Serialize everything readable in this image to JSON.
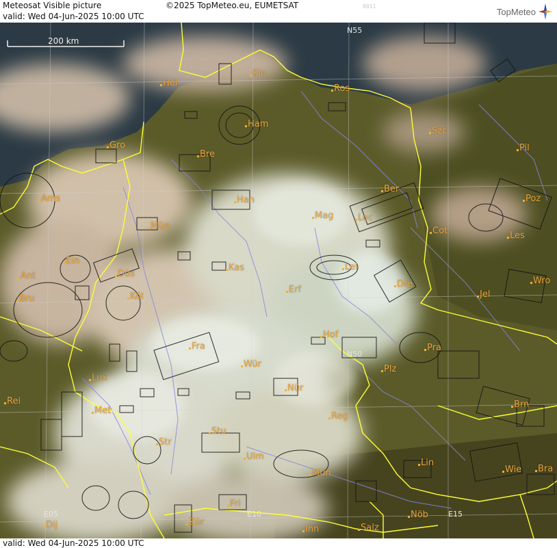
{
  "header": {
    "product_title": "Meteosat Visible picture",
    "copyright": "©2025 TopMeteo.eu, EUMETSAT",
    "image_code": "8011",
    "valid_line": "valid:  Wed  04-Jun-2025  10:00 UTC",
    "logo_text": "TopMeteo"
  },
  "footer": {
    "valid_line": "valid:  Wed  04-Jun-2025  10:00 UTC"
  },
  "map": {
    "scale_label": "200 km",
    "grid_labels": {
      "n55": "N55",
      "n50": "N50",
      "e05": "E05",
      "e10": "E10",
      "e15": "E15"
    },
    "cities": [
      "Kie",
      "Hel",
      "Ros",
      "Ham",
      "Szc",
      "Gro",
      "Bre",
      "Pil",
      "Ams",
      "Han",
      "Ber",
      "Poz",
      "Mün",
      "Mag",
      "Loc",
      "Cot",
      "Les",
      "Ein",
      "Kas",
      "Lei",
      "Ant",
      "Düs",
      "Dre",
      "Wro",
      "Bru",
      "Köl",
      "Erf",
      "Jel",
      "Hof",
      "Fra",
      "Pra",
      "Lux",
      "Wür",
      "Plz",
      "Rei",
      "Nür",
      "Met",
      "Reg",
      "Brn",
      "Stu",
      "Str",
      "Ulm",
      "Lin",
      "Mün",
      "Wie",
      "Bra",
      "Fri",
      "Zür",
      "Dij",
      "Inn",
      "Salz",
      "Nöb"
    ]
  },
  "colors": {
    "border": "#ffff33",
    "river": "#8a8ae6",
    "city_label": "#e8a23a",
    "grid": "#cfcfcf",
    "outline": "#1a1a1a"
  }
}
